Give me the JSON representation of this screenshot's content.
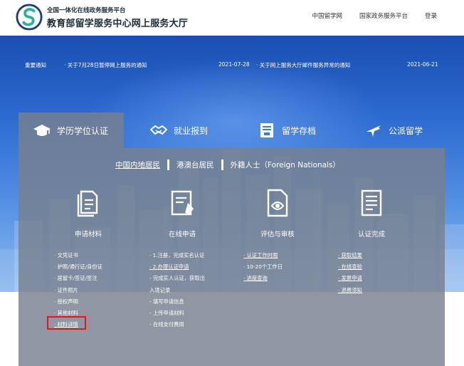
{
  "header": {
    "subtitle": "全国一体化在线政务服务平台",
    "title": "教育部留学服务中心网上服务大厅",
    "nav": [
      "中国留学网",
      "国家政务服务平台",
      "登录"
    ]
  },
  "notices": {
    "label": "重要通知",
    "items": [
      {
        "title": "· 关于7月28日暂停网上服务的通知",
        "date": "2021-07-28"
      },
      {
        "title": "· 关于网上服务大厅邮件服务异常的通知",
        "date": "2021-06-21"
      }
    ]
  },
  "tabs": [
    {
      "label": "学历学位认证",
      "icon": "graduation-cap-icon",
      "active": true
    },
    {
      "label": "就业报到",
      "icon": "handshake-icon",
      "active": false
    },
    {
      "label": "留学存档",
      "icon": "archive-icon",
      "active": false
    },
    {
      "label": "公派留学",
      "icon": "airplane-icon",
      "active": false
    }
  ],
  "subtabs": [
    {
      "label": "中国内地居民",
      "selected": true
    },
    {
      "label": "港澳台居民",
      "selected": false
    },
    {
      "label": "外籍人士（Foreign Nationals）",
      "selected": false
    }
  ],
  "steps": [
    {
      "label": "申请材料",
      "icon": "documents-icon",
      "items": [
        "· 文凭证书",
        "· 护照/通行证/身份证",
        "· 居留卡/签证/签注",
        "· 证件照片",
        "· 授权声明",
        "· 其他材料",
        "· 材料详情"
      ]
    },
    {
      "label": "在线申请",
      "icon": "form-edit-icon",
      "items": [
        "· 1.注册，完成实名认证",
        "· 2.办理认证申请",
        "- 完成实人认证，获取出",
        "入境记录",
        "- 填写申请信息",
        "- 上传申请材料",
        "- 在线支付费用"
      ]
    },
    {
      "label": "评估与审核",
      "icon": "document-eye-icon",
      "items": [
        "· 认证工作时限",
        "· 10-20个工作日",
        "· 进度查询"
      ]
    },
    {
      "label": "认证完成",
      "icon": "report-icon",
      "items": [
        "· 获取结果",
        "· 在线查验",
        "· 发票申请",
        "· 退费须知"
      ]
    }
  ],
  "colors": {
    "banner_blue": "#2b68cf",
    "panel_gray": "#78808e",
    "highlight_red": "#e8161b"
  }
}
